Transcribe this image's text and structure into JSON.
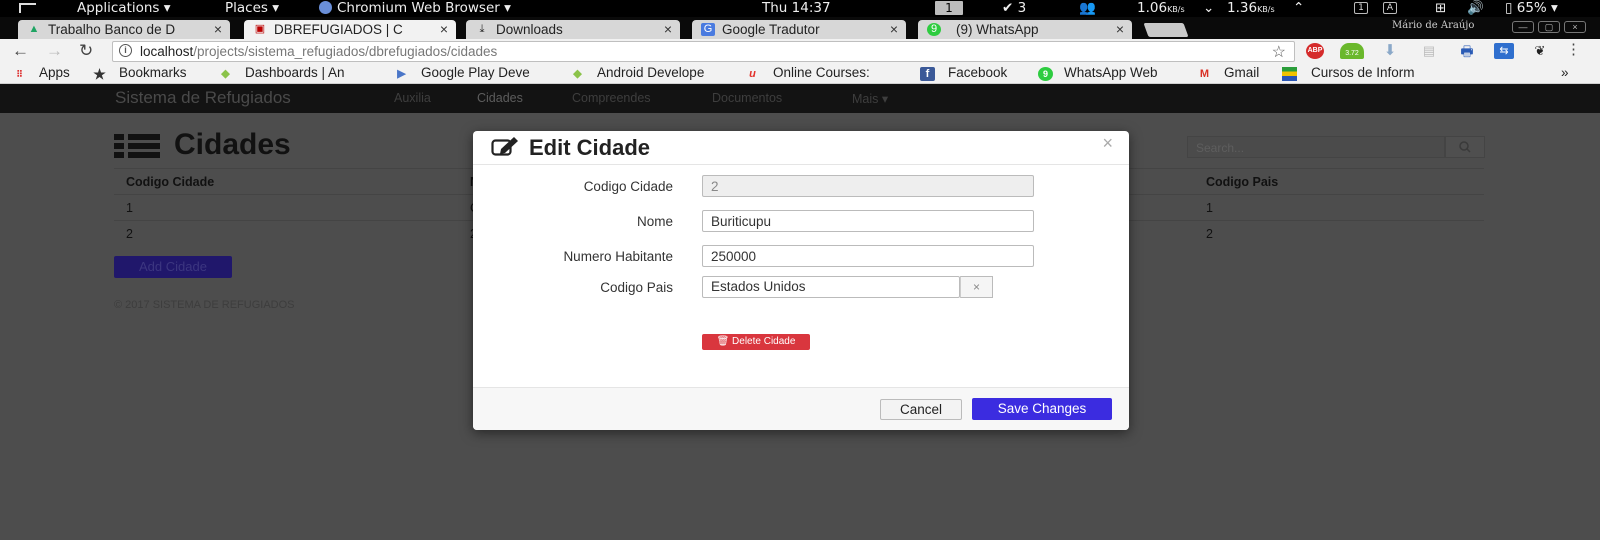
{
  "topbar": {
    "applications": "Applications",
    "places": "Places",
    "browser_menu": "Chromium Web Browser",
    "clock": "Thu 14:37",
    "workspace": "1",
    "updates": "3",
    "net_down": "1.06",
    "net_down_unit": "KB/s",
    "net_up": "1.36",
    "net_up_unit": "KB/s",
    "indicator1": "1",
    "indicator2": "A",
    "battery": "65%"
  },
  "tabs": [
    {
      "label": "Trabalho Banco de D",
      "active": false
    },
    {
      "label": "DBREFUGIADOS | C",
      "active": true
    },
    {
      "label": "Downloads",
      "active": false
    },
    {
      "label": "Google Tradutor",
      "active": false
    },
    {
      "label": "(9) WhatsApp",
      "active": false
    }
  ],
  "window_user": "Mário de Araújo",
  "address": {
    "host": "localhost",
    "path": "/projects/sistema_refugiados/dbrefugiados/cidades"
  },
  "extensions": {
    "abp": "ABP",
    "badge": "3.72"
  },
  "bookmarks": [
    {
      "label": "Apps"
    },
    {
      "label": "Bookmarks"
    },
    {
      "label": "Dashboards | An"
    },
    {
      "label": "Google Play Deve"
    },
    {
      "label": "Android Develope"
    },
    {
      "label": "Online Courses: "
    },
    {
      "label": "Facebook"
    },
    {
      "label": "WhatsApp Web"
    },
    {
      "label": "Gmail"
    },
    {
      "label": "Cursos de Inform"
    }
  ],
  "bookmarks_more": "»",
  "app": {
    "brand": "Sistema de Refugiados",
    "nav": [
      "Auxilia",
      "Cidades",
      "Compreendes",
      "Documentos",
      "Mais"
    ],
    "page_title": "Cidades",
    "search_placeholder": "Search...",
    "table": {
      "headers": [
        "Codigo Cidade",
        "N",
        "Codigo Pais"
      ],
      "rows": [
        [
          "1",
          "C",
          "1"
        ],
        [
          "2",
          "2",
          "2"
        ]
      ]
    },
    "add_button": "Add Cidade",
    "footer": "© 2017 SISTEMA DE REFUGIADOS"
  },
  "modal": {
    "title": "Edit Cidade",
    "close": "×",
    "fields": {
      "codigo_cidade": {
        "label": "Codigo Cidade",
        "value": "2"
      },
      "nome": {
        "label": "Nome",
        "value": "Buriticupu"
      },
      "numero_habitante": {
        "label": "Numero Habitante",
        "value": "250000"
      },
      "codigo_pais": {
        "label": "Codigo Pais",
        "value": "Estados Unidos"
      }
    },
    "select_clear": "×",
    "delete_button": "Delete Cidade",
    "cancel_button": "Cancel",
    "save_button": "Save Changes"
  },
  "colors": {
    "save": "#3b2ce0",
    "delete": "#d9363e",
    "overlay": "#4d4d4d"
  }
}
